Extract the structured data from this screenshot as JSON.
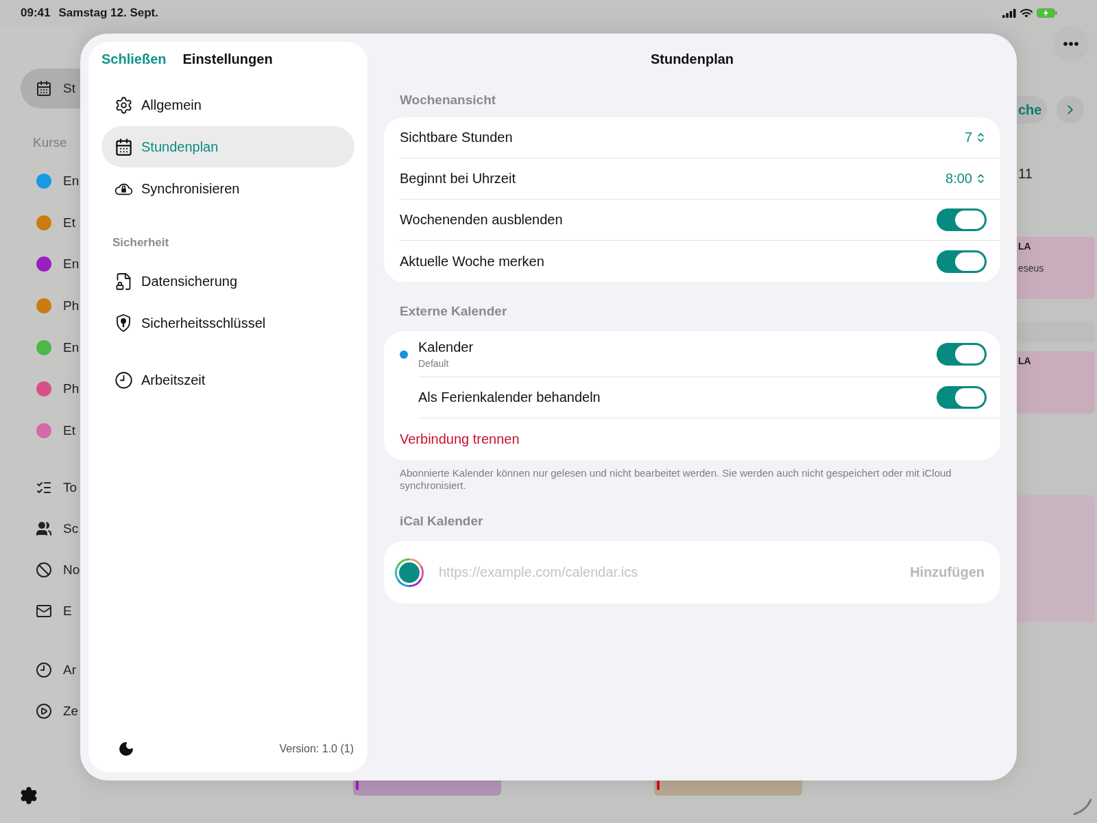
{
  "status_bar": {
    "time": "09:41",
    "date": "Samstag 12. Sept."
  },
  "app_sidebar": {
    "nav": [
      {
        "label": "St",
        "selected": true
      }
    ],
    "section_title": "Kurse",
    "courses": [
      {
        "label": "En",
        "color": "#1a9ae4"
      },
      {
        "label": "Et",
        "color": "#c97c12"
      },
      {
        "label": "En",
        "color": "#9a1fc0"
      },
      {
        "label": "Ph",
        "color": "#c97c12"
      },
      {
        "label": "En",
        "color": "#4db847"
      },
      {
        "label": "Ph",
        "color": "#d65189"
      },
      {
        "label": "Et",
        "color": "#d46aa8"
      }
    ],
    "tools": [
      {
        "label": "To"
      },
      {
        "label": "Sc"
      },
      {
        "label": "No"
      },
      {
        "label": "E"
      }
    ],
    "extras": [
      {
        "label": "Ar"
      },
      {
        "label": "Ze"
      }
    ]
  },
  "app_main": {
    "week_button": "che",
    "day_label": "11",
    "events": [
      {
        "title": "LA",
        "subtitle": "eseus",
        "color": "#c9adbd"
      },
      {
        "color": "#bdbdbb"
      },
      {
        "title": "LA",
        "color": "#c9adbd"
      },
      {
        "color": "#c9b4c2"
      }
    ],
    "bottom_events": [
      {
        "color": "#b394b5",
        "stripe": {
          "color": "#9b1fc0"
        }
      },
      {
        "color": "#b8a792",
        "stripe": {
          "color": "#d01010"
        }
      }
    ]
  },
  "settings": {
    "close": "Schließen",
    "title": "Einstellungen",
    "groups": [
      {
        "items": [
          {
            "label": "Allgemein",
            "selected": false
          },
          {
            "label": "Stundenplan",
            "selected": true
          },
          {
            "label": "Synchronisieren",
            "selected": false
          }
        ]
      },
      {
        "header": "Sicherheit",
        "items": [
          {
            "label": "Datensicherung",
            "selected": false
          },
          {
            "label": "Sicherheitsschlüssel",
            "selected": false
          }
        ]
      },
      {
        "items": [
          {
            "label": "Arbeitszeit",
            "selected": false
          }
        ]
      }
    ],
    "version": "Version: 1.0 (1)"
  },
  "detail": {
    "title": "Stundenplan",
    "sections": [
      {
        "header": "Wochenansicht",
        "rows": [
          {
            "kind": "stepper",
            "label": "Sichtbare Stunden",
            "value": "7"
          },
          {
            "kind": "stepper",
            "label": "Beginnt bei Uhrzeit",
            "value": "8:00"
          },
          {
            "kind": "toggle",
            "label": "Wochenenden ausblenden",
            "on": true
          },
          {
            "kind": "toggle",
            "label": "Aktuelle Woche merken",
            "on": true
          }
        ]
      },
      {
        "header": "Externe Kalender",
        "rows": [
          {
            "kind": "calendar",
            "label": "Kalender",
            "sublabel": "Default",
            "color": "#1a8fe0",
            "on": true
          },
          {
            "kind": "subtoggle",
            "label": "Als Ferienkalender behandeln",
            "on": true
          },
          {
            "kind": "action",
            "label": "Verbindung trennen"
          }
        ],
        "footer": "Abonnierte Kalender können nur gelesen und nicht bearbeitet werden. Sie werden auch nicht gespeichert oder mit iCloud synchronisiert."
      },
      {
        "header": "iCal Kalender",
        "rows": [
          {
            "kind": "url",
            "placeholder": "https://example.com/calendar.ics",
            "button": "Hinzufügen"
          }
        ]
      }
    ]
  }
}
